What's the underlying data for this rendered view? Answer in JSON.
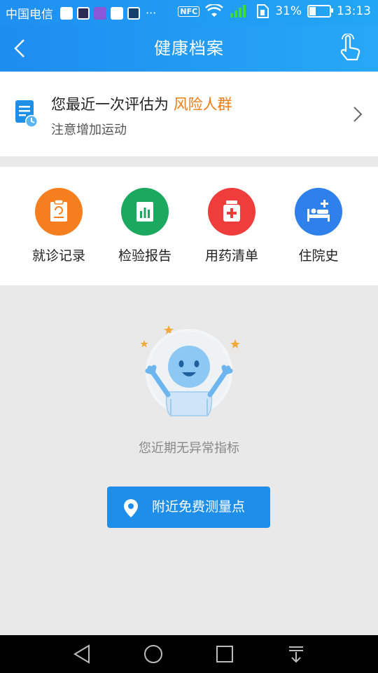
{
  "status_bar": {
    "carrier": "中国电信",
    "overflow": "···",
    "nfc": "NFC",
    "battery_pct": "31%",
    "battery_level": 0.31,
    "time": "13:13"
  },
  "header": {
    "title": "健康档案",
    "back_icon": "chevron-left-icon",
    "action_icon": "hand-pointer-icon"
  },
  "assessment": {
    "prefix": "您最近一次评估为",
    "risk": "风险人群",
    "tip": "注意增加运动",
    "risk_color": "#f07d13"
  },
  "categories": [
    {
      "label": "就诊记录",
      "icon": "clipboard-icon",
      "color": "#f57f1f"
    },
    {
      "label": "检验报告",
      "icon": "report-chart-icon",
      "color": "#1aa95e"
    },
    {
      "label": "用药清单",
      "icon": "medicine-box-icon",
      "color": "#ef3d3b"
    },
    {
      "label": "住院史",
      "icon": "hospital-bed-icon",
      "color": "#2e80ea"
    }
  ],
  "empty_state": {
    "message": "您近期无异常指标"
  },
  "nearby_button": {
    "label": "附近免费测量点",
    "icon": "location-pin-icon"
  },
  "navbar": {
    "back": "back-triangle-icon",
    "home": "home-circle-icon",
    "recent": "recent-square-icon",
    "notification": "pull-down-icon"
  },
  "colors": {
    "brand_blue": "#1f8ff1",
    "button_blue": "#1f8ee8",
    "background": "#e9e9e9"
  }
}
